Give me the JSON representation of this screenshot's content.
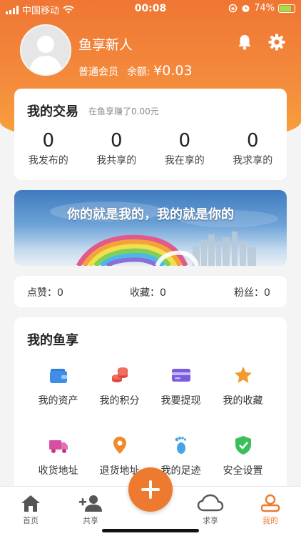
{
  "status_bar": {
    "carrier": "中国移动",
    "time": "00:08",
    "battery": "74%"
  },
  "profile": {
    "username": "鱼享新人",
    "member_level": "普通会员",
    "balance_label": "余额:",
    "balance_amount": "¥0.03"
  },
  "trade": {
    "title": "我的交易",
    "subtitle": "在鱼享赚了0.00元",
    "stats": [
      {
        "value": "0",
        "label": "我发布的"
      },
      {
        "value": "0",
        "label": "我共享的"
      },
      {
        "value": "0",
        "label": "我在享的"
      },
      {
        "value": "0",
        "label": "我求享的"
      }
    ]
  },
  "banner": {
    "text": "你的就是我的，我的就是你的"
  },
  "social": {
    "likes": "点赞：0",
    "favorites": "收藏：0",
    "fans": "粉丝：0"
  },
  "menu": {
    "title": "我的鱼享",
    "items": [
      {
        "label": "我的资产",
        "icon": "wallet-icon"
      },
      {
        "label": "我的积分",
        "icon": "coins-icon"
      },
      {
        "label": "我要提现",
        "icon": "card-icon"
      },
      {
        "label": "我的收藏",
        "icon": "star-icon"
      },
      {
        "label": "收货地址",
        "icon": "truck-icon"
      },
      {
        "label": "退货地址",
        "icon": "location-pin-icon"
      },
      {
        "label": "我的足迹",
        "icon": "footprint-icon"
      },
      {
        "label": "安全设置",
        "icon": "shield-check-icon"
      }
    ]
  },
  "tabbar": {
    "items": [
      {
        "label": "首页",
        "icon": "home-icon"
      },
      {
        "label": "共享",
        "icon": "add-user-icon"
      },
      {
        "label": "求享",
        "icon": "cloud-icon"
      },
      {
        "label": "我的",
        "icon": "user-icon"
      }
    ],
    "active": "我的",
    "fab_icon": "plus-icon"
  },
  "colors": {
    "accent": "#ee7a30",
    "header_top": "#ef7633",
    "header_bottom": "#f7a33c"
  }
}
